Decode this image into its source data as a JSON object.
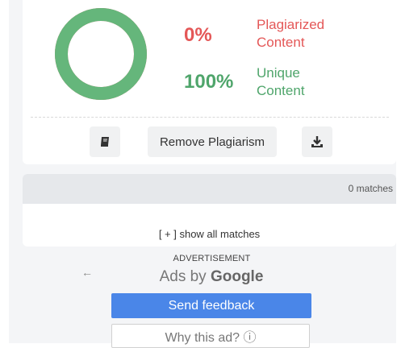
{
  "result": {
    "plagiarized": {
      "percent": "0%",
      "line1": "Plagiarized",
      "line2": "Content",
      "color": "#e45757"
    },
    "unique": {
      "percent": "100%",
      "line1": "Unique",
      "line2": "Content",
      "color": "#4fa56b"
    },
    "donut_fraction_unique": 1.0,
    "actions": {
      "book_icon": "book-icon",
      "remove_label": "Remove Plagiarism",
      "download_icon": "download-icon"
    }
  },
  "matches": {
    "count_label": "0 matches",
    "show_all_label": "[ + ] show all matches"
  },
  "ad": {
    "label": "ADVERTISEMENT",
    "back_icon": "arrow-left-icon",
    "ads_by_prefix": "Ads by",
    "ads_by_brand": "Google",
    "feedback_label": "Send feedback",
    "why_label": "Why this ad? ⓘ",
    "accent": "#4a86e8"
  }
}
